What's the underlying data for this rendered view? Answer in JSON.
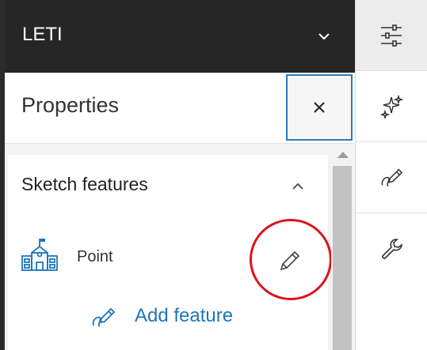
{
  "header": {
    "title": "LETI"
  },
  "panel": {
    "title": "Properties"
  },
  "section": {
    "title": "Sketch features",
    "feature": {
      "label": "Point"
    },
    "add_feature_label": "Add feature"
  },
  "actions": [
    "settings-sliders",
    "sparkle",
    "sketch-pencil",
    "wrench"
  ],
  "colors": {
    "header_bg": "#262626",
    "accent": "#1f76b8",
    "focus_border": "#2b7bbd",
    "highlight_circle": "#e0121c"
  }
}
